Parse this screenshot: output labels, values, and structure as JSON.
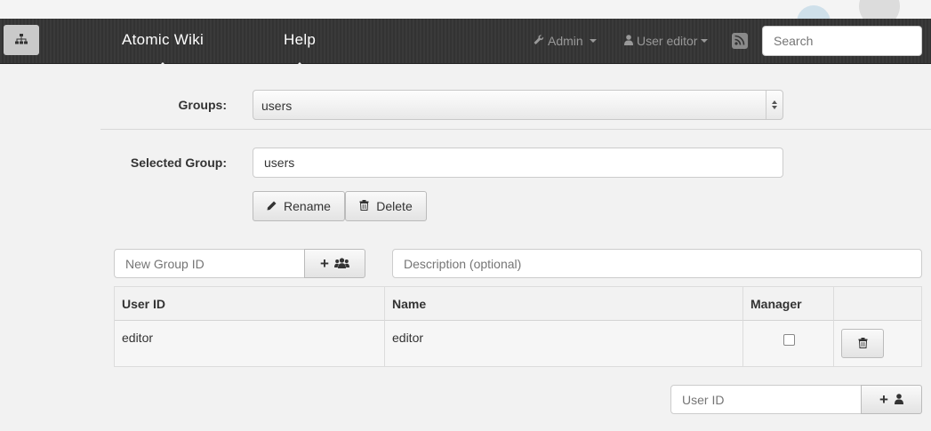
{
  "navbar": {
    "brand_icon": "sitemap-icon",
    "links": [
      {
        "label": "Atomic Wiki"
      },
      {
        "label": "Help"
      }
    ],
    "admin_menu": {
      "label": "Admin",
      "icon": "wrench-icon"
    },
    "user_menu": {
      "label": "User editor",
      "icon": "user-icon"
    },
    "rss_icon": "rss-icon",
    "search": {
      "placeholder": "Search",
      "value": ""
    }
  },
  "groups": {
    "label": "Groups:",
    "selected": "users"
  },
  "selected_group": {
    "label": "Selected Group:",
    "value": "users",
    "rename_label": "Rename",
    "delete_label": "Delete"
  },
  "new_group": {
    "id_placeholder": "New Group ID",
    "add_label": "+",
    "description_placeholder": "Description (optional)"
  },
  "members_table": {
    "headers": [
      "User ID",
      "Name",
      "Manager",
      ""
    ],
    "rows": [
      {
        "user_id": "editor",
        "name": "editor",
        "manager": false
      }
    ]
  },
  "add_user": {
    "placeholder": "User ID",
    "add_label": "+"
  },
  "colors": {
    "navbar_bg": "#333333",
    "page_bg": "#f2f2f2"
  }
}
